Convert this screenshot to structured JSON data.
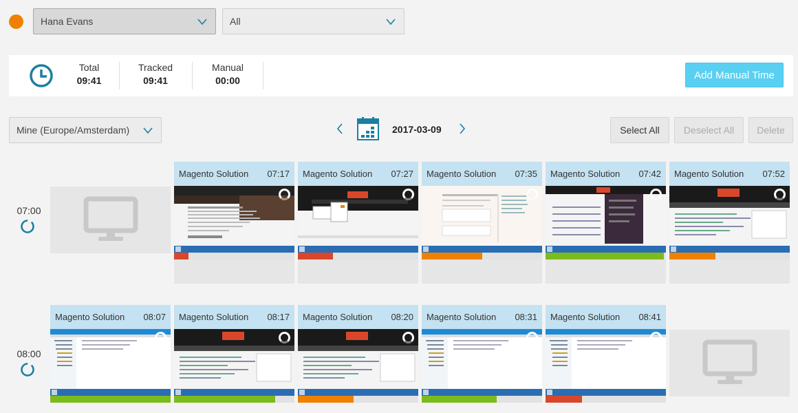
{
  "header": {
    "user_select": "Hana  Evans",
    "filter_select": "All"
  },
  "stats": {
    "total_label": "Total",
    "total_value": "09:41",
    "tracked_label": "Tracked",
    "tracked_value": "09:41",
    "manual_label": "Manual",
    "manual_value": "00:00",
    "add_button": "Add  Manual  Time"
  },
  "toolbar": {
    "timezone": "Mine  (Europe/Amsterdam)",
    "date": "2017-03-09",
    "select_all": "Select  All",
    "deselect_all": "Deselect  All",
    "delete": "Delete"
  },
  "colors": {
    "accent": "#1b7fa1",
    "orange_dot": "#ee8200",
    "head_bg": "#c4e2f1",
    "red": "#d9472b",
    "orange": "#ee8200",
    "green": "#7cbb1c"
  },
  "rows": [
    {
      "hour": "07:00",
      "cards": [
        {
          "project": "Magento  Solution",
          "time": "07:17",
          "activity": 0.12,
          "activity_color": "red",
          "theme": "dark-photo"
        },
        {
          "project": "Magento  Solution",
          "time": "07:27",
          "activity": 0.29,
          "activity_color": "red",
          "theme": "menu"
        },
        {
          "project": "Magento  Solution",
          "time": "07:35",
          "activity": 0.5,
          "activity_color": "orange",
          "theme": "light-doc"
        },
        {
          "project": "Magento  Solution",
          "time": "07:42",
          "activity": 0.98,
          "activity_color": "green",
          "theme": "chat"
        },
        {
          "project": "Magento  Solution",
          "time": "07:52",
          "activity": 0.38,
          "activity_color": "orange",
          "theme": "code-dark"
        }
      ]
    },
    {
      "hour": "08:00",
      "cards": [
        {
          "project": "Magento  Solution",
          "time": "08:07",
          "activity": 1.0,
          "activity_color": "green",
          "theme": "explorer"
        },
        {
          "project": "Magento  Solution",
          "time": "08:17",
          "activity": 0.84,
          "activity_color": "green",
          "theme": "code-dark"
        },
        {
          "project": "Magento  Solution",
          "time": "08:20",
          "activity": 0.46,
          "activity_color": "orange",
          "theme": "code-dark"
        },
        {
          "project": "Magento  Solution",
          "time": "08:31",
          "activity": 0.62,
          "activity_color": "green",
          "theme": "explorer"
        },
        {
          "project": "Magento  Solution",
          "time": "08:41",
          "activity": 0.3,
          "activity_color": "red",
          "theme": "explorer"
        }
      ]
    }
  ]
}
